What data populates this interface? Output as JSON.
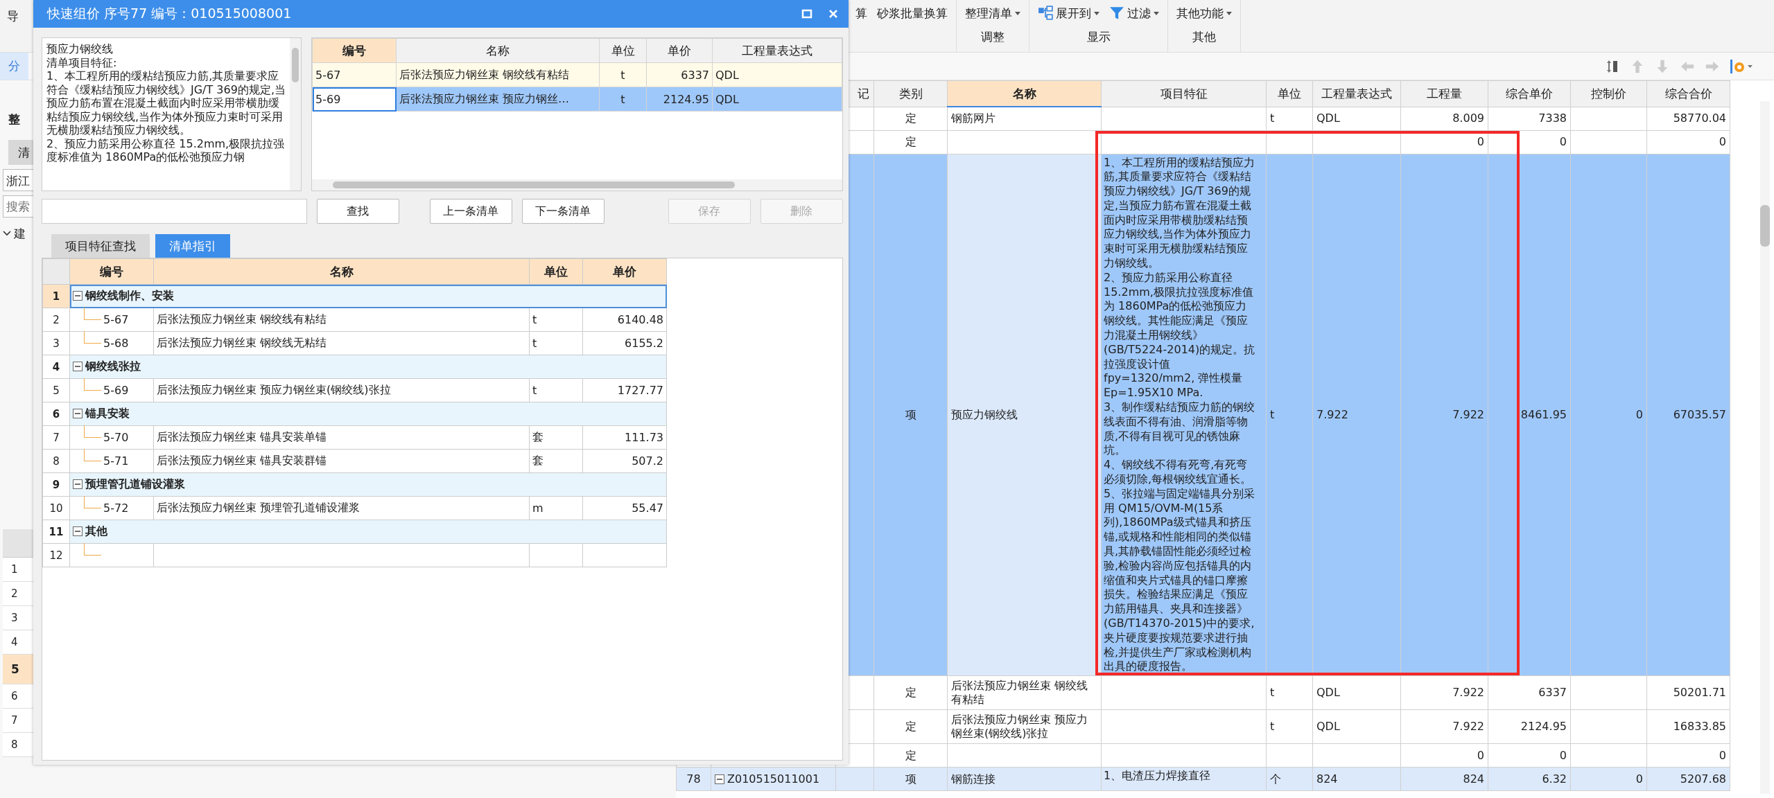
{
  "background": {
    "ribbon": {
      "left_fragment": "导",
      "cut_button": "算",
      "plain_button": "砂浆批量换算",
      "groups": [
        {
          "label": "调整",
          "buttons": [
            {
              "label": "整理清单"
            }
          ]
        },
        {
          "label": "显示",
          "buttons": [
            {
              "label": "展开到"
            },
            {
              "label": "过滤"
            }
          ]
        },
        {
          "label": "其他",
          "buttons": [
            {
              "label": "其他功能"
            }
          ]
        }
      ]
    },
    "subbar": {
      "tab": "分"
    },
    "left_panel": {
      "heading": "整",
      "tab": "清",
      "region": "浙江",
      "search_placeholder": "搜索",
      "tree_root": {
        "label": "建",
        "expanded": true
      },
      "row_numbers": [
        {
          "label": "1",
          "selected": false
        },
        {
          "label": "2",
          "selected": false
        },
        {
          "label": "3",
          "selected": false
        },
        {
          "label": "4",
          "selected": false
        },
        {
          "label": "5",
          "selected": true
        },
        {
          "label": "6",
          "selected": false
        },
        {
          "label": "7",
          "selected": false
        },
        {
          "label": "8",
          "selected": false
        }
      ]
    },
    "table": {
      "columns": [
        {
          "label": "记",
          "highlighted": false
        },
        {
          "label": "类别",
          "highlighted": false
        },
        {
          "label": "名称",
          "highlighted": true
        },
        {
          "label": "项目特征",
          "highlighted": false
        },
        {
          "label": "单位",
          "highlighted": false
        },
        {
          "label": "工程量表达式",
          "highlighted": false
        },
        {
          "label": "工程量",
          "highlighted": false
        },
        {
          "label": "综合单价",
          "highlighted": false
        },
        {
          "label": "控制价",
          "highlighted": false
        },
        {
          "label": "综合合价",
          "highlighted": false
        }
      ],
      "rows": [
        {
          "type": "定",
          "name": "钢筋网片",
          "unit": "t",
          "expr": "QDL",
          "qty": "8.009",
          "unit_price": "7338",
          "total": "58770.04",
          "selected": false
        },
        {
          "type": "定",
          "qty": "0",
          "unit_price": "0",
          "total": "0",
          "selected": false
        },
        {
          "type": "项",
          "name": "预应力钢绞线",
          "feature": [
            "1、本工程所用的缓粘结预应力筋,其质量要求应符合《缓粘结预应力钢绞线》JG/T 369的规定,当预应力筋布置在混凝土截面内时应采用带横肋缓粘结预应力钢绞线,当作为体外预应力束时可采用无横肋缓粘结预应力钢绞线。",
            "2、预应力筋采用公称直径15.2mm,极限抗拉强度标准值为 1860MPa的低松弛预应力钢绞线。其性能应满足《预应力混凝土用钢绞线》 (GB/T5224-2014)的规定。抗拉强度设计值fpy=1320/mm2, 弹性模量 Ep=1.95X10 MPa.",
            "3、制作缓粘结预应力筋的钢绞线表面不得有油、润滑脂等物质,不得有目视可见的锈蚀麻坑。",
            "4、钢绞线不得有死弯,有死弯必须切除,每根钢绞线宜通长。",
            "5、张拉端与固定端锚具分别采用 QM15/OVM-M(15系列),1860MPa级式锚具和挤压锚,或规格和性能相同的类似锚具,其静载锚固性能必须经过检验,检验内容尚应包括锚具的内缩值和夹片式锚具的锚口摩擦损失。检验结果应满足《预应力筋用锚具、夹具和连接器》 (GB/T14370-2015)中的要求,夹片硬度要按规范要求进行抽检,并提供生产厂家或检测机构出具的硬度报告。"
          ],
          "unit": "t",
          "expr": "7.922",
          "qty": "7.922",
          "unit_price": "8461.95",
          "control_price": "0",
          "total": "67035.57",
          "selected": true
        },
        {
          "type": "定",
          "name": "后张法预应力钢丝束 钢绞线有粘结",
          "unit": "t",
          "expr": "QDL",
          "qty": "7.922",
          "unit_price": "6337",
          "total": "50201.71",
          "selected": false
        },
        {
          "type": "定",
          "name": "后张法预应力钢丝束 预应力钢丝束(钢绞线)张拉",
          "unit": "t",
          "expr": "QDL",
          "qty": "7.922",
          "unit_price": "2124.95",
          "total": "16833.85",
          "selected": false
        },
        {
          "type": "定",
          "qty": "0",
          "unit_price": "0",
          "total": "0",
          "selected": false
        },
        {
          "number": "78",
          "code": "Z010515011001",
          "expanded": true,
          "type": "项",
          "name": "钢筋连接",
          "feature": [
            "1、电渣压力焊接直径"
          ],
          "unit": "个",
          "expr": "824",
          "qty": "824",
          "unit_price": "6.32",
          "control_price": "0",
          "total": "5207.68",
          "selected": false
        }
      ]
    }
  },
  "dialog": {
    "title": "快速组价 序号77 编号：010515008001",
    "feature_lines": [
      "预应力钢绞线",
      "清单项目特征:",
      "1、本工程所用的缓粘结预应力筋,其质量要求应符合《缓粘结预应力钢绞线》JG/T 369的规定,当预应力筋布置在混凝土截面内时应采用带横肋缓粘结预应力钢绞线,当作为体外预应力束时可采用无横肋缓粘结预应力钢绞线。",
      "2、预应力筋采用公称直径 15.2mm,极限抗拉强度标准值为 1860MPa的低松弛预应力钢"
    ],
    "quota_grid": {
      "columns": [
        {
          "label": "编号",
          "highlighted": true
        },
        {
          "label": "名称",
          "highlighted": false
        },
        {
          "label": "单位",
          "highlighted": false
        },
        {
          "label": "单价",
          "highlighted": false
        },
        {
          "label": "工程量表达式",
          "highlighted": false
        }
      ],
      "rows": [
        {
          "code": "5-67",
          "name": "后张法预应力钢丝束 钢绞线有粘结",
          "unit": "t",
          "price": "6337",
          "expr": "QDL",
          "selected": false
        },
        {
          "code": "5-69",
          "name": "后张法预应力钢丝束 预应力钢丝…",
          "unit": "t",
          "price": "2124.95",
          "expr": "QDL",
          "selected": true
        }
      ]
    },
    "buttons": [
      {
        "label": "查找",
        "kind": "search",
        "disabled": false
      },
      {
        "label": "上一条清单",
        "kind": "nav",
        "disabled": false
      },
      {
        "label": "下一条清单",
        "kind": "nav",
        "disabled": false
      },
      {
        "label": "保存",
        "kind": "action",
        "disabled": true
      },
      {
        "label": "删除",
        "kind": "action",
        "disabled": true
      }
    ],
    "tabs": [
      {
        "label": "项目特征查找",
        "selected": false
      },
      {
        "label": "清单指引",
        "selected": true
      }
    ],
    "guide": {
      "columns": [
        "编号",
        "名称",
        "单位",
        "单价"
      ],
      "groups": [
        {
          "number": "1",
          "title": "钢绞线制作、安装",
          "expanded": true,
          "selected": true,
          "children": [
            {
              "number": "2",
              "code": "5-67",
              "name": "后张法预应力钢丝束 钢绞线有粘结",
              "unit": "t",
              "price": "6140.48",
              "selected": false
            },
            {
              "number": "3",
              "code": "5-68",
              "name": "后张法预应力钢丝束 钢绞线无粘结",
              "unit": "t",
              "price": "6155.2",
              "selected": false
            }
          ]
        },
        {
          "number": "4",
          "title": "钢绞线张拉",
          "expanded": true,
          "selected": false,
          "children": [
            {
              "number": "5",
              "code": "5-69",
              "name": "后张法预应力钢丝束 预应力钢丝束(钢绞线)张拉",
              "unit": "t",
              "price": "1727.77",
              "selected": false
            }
          ]
        },
        {
          "number": "6",
          "title": "锚具安装",
          "expanded": true,
          "selected": false,
          "children": [
            {
              "number": "7",
              "code": "5-70",
              "name": "后张法预应力钢丝束 锚具安装单锚",
              "unit": "套",
              "price": "111.73",
              "selected": false
            },
            {
              "number": "8",
              "code": "5-71",
              "name": "后张法预应力钢丝束 锚具安装群锚",
              "unit": "套",
              "price": "507.2",
              "selected": false
            }
          ]
        },
        {
          "number": "9",
          "title": "预埋管孔道铺设灌浆",
          "expanded": true,
          "selected": false,
          "children": [
            {
              "number": "10",
              "code": "5-72",
              "name": "后张法预应力钢丝束 预埋管孔道铺设灌浆",
              "unit": "m",
              "price": "55.47",
              "selected": false
            }
          ]
        },
        {
          "number": "11",
          "title": "其他",
          "expanded": true,
          "selected": false,
          "children": [
            {
              "number": "12",
              "selected": false
            }
          ]
        }
      ]
    }
  }
}
